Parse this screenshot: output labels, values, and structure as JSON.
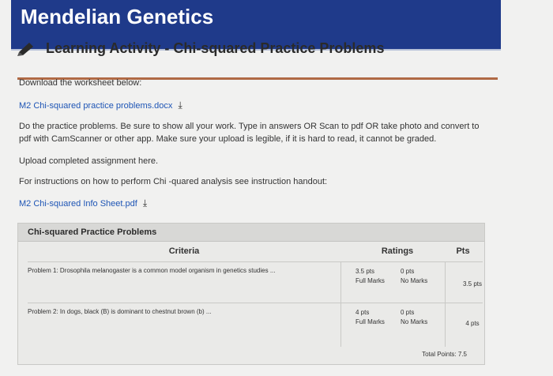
{
  "banner": {
    "title": "Mendelian Genetics",
    "color": "#1f3a8a"
  },
  "page": {
    "title": "Learning Activity - Chi-squared Practice Problems",
    "icon": "pencil-icon"
  },
  "content": {
    "download_label": "Download the worksheet below:",
    "worksheet_link": "M2 Chi-squared practice problems.docx",
    "instructions": "Do the practice problems. Be sure to show all your work. Type in answers OR Scan to pdf OR take photo and convert to pdf with CamScanner or other app. Make sure your upload is legible, if it is hard to read, it cannot be graded.",
    "upload_label": "Upload completed assignment here.",
    "chi_instructions": "For instructions on how to perform Chi -quared analysis see instruction handout:",
    "info_link": "M2 Chi-squared Info Sheet.pdf",
    "download_icon": "download-icon"
  },
  "rubric": {
    "title": "Chi-squared Practice Problems",
    "headers": {
      "criteria": "Criteria",
      "ratings": "Ratings",
      "pts": "Pts"
    },
    "rows": [
      {
        "criteria": "Problem 1: Drosophila melanogaster is a common model organism in genetics studies ...",
        "rating1_pts": "3.5 pts",
        "rating1_label": "Full Marks",
        "rating2_pts": "0 pts",
        "rating2_label": "No Marks",
        "pts": "3.5 pts"
      },
      {
        "criteria": "Problem 2: In dogs, black (B) is dominant to chestnut brown (b) ...",
        "rating1_pts": "4 pts",
        "rating1_label": "Full Marks",
        "rating2_pts": "0 pts",
        "rating2_label": "No Marks",
        "pts": "4 pts"
      }
    ],
    "total": "Total Points: 7.5"
  }
}
